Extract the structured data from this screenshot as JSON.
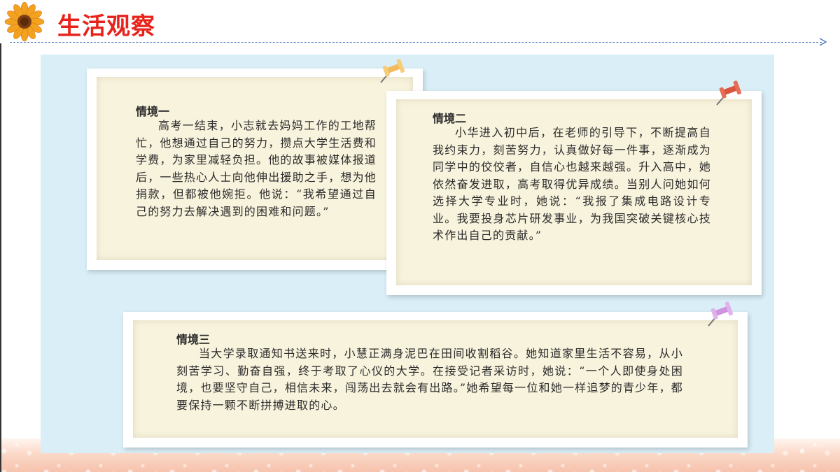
{
  "header": {
    "title": "生活观察"
  },
  "colors": {
    "title": "#e8231b",
    "panel_background": "#daeef8",
    "card_paper": "#f8f3dd",
    "divider": "#4a78c2",
    "pin_yellow": "#f4c36a",
    "pin_red": "#e0674e",
    "pin_purple": "#d9a6e6"
  },
  "icons": {
    "logo": "sunflower-icon",
    "pins": [
      "pushpin-icon",
      "pushpin-icon",
      "pushpin-icon"
    ]
  },
  "scenarios": [
    {
      "title": "情境一",
      "body": "高考一结束，小志就去妈妈工作的工地帮忙，他想通过自己的努力，攒点大学生活费和学费，为家里减轻负担。他的故事被媒体报道后，一些热心人士向他伸出援助之手，想为他捐款，但都被他婉拒。他说：“我希望通过自己的努力去解决遇到的困难和问题。”"
    },
    {
      "title": "情境二",
      "body": "小华进入初中后，在老师的引导下，不断提高自我约束力，刻苦努力，认真做好每一件事，逐渐成为同学中的佼佼者，自信心也越来越强。升入高中，她依然奋发进取，高考取得优异成绩。当别人问她如何选择大学专业时，她说：“我报了集成电路设计专业。我要投身芯片研发事业，为我国突破关键核心技术作出自己的贡献。”"
    },
    {
      "title": "情境三",
      "body": "当大学录取通知书送来时，小慧正满身泥巴在田间收割稻谷。她知道家里生活不容易，从小刻苦学习、勤奋自强，终于考取了心仪的大学。在接受记者采访时，她说：“一个人即使身处困境，也要坚守自己，相信未来，闯荡出去就会有出路。”她希望每一位和她一样追梦的青少年，都要保持一颗不断拼搏进取的心。"
    }
  ]
}
